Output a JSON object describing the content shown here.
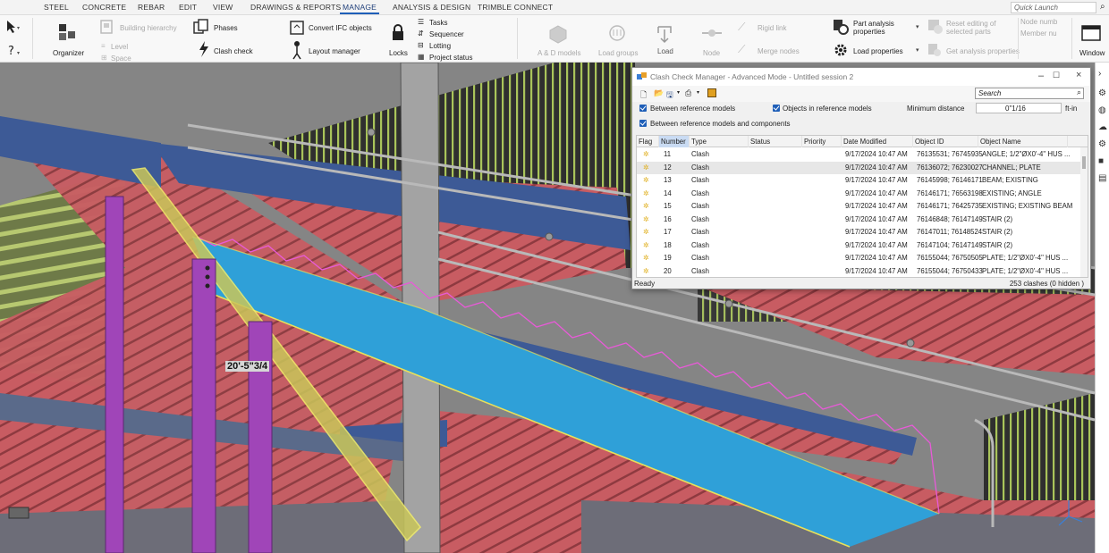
{
  "menu": [
    "STEEL",
    "CONCRETE",
    "REBAR",
    "EDIT",
    "VIEW",
    "DRAWINGS & REPORTS",
    "MANAGE",
    "ANALYSIS & DESIGN",
    "TRIMBLE CONNECT"
  ],
  "quick_launch_placeholder": "Quick Launch",
  "ribbon": {
    "organizer": "Organizer",
    "building_hierarchy": "Building hierarchy",
    "level": "Level",
    "space": "Space",
    "phases": "Phases",
    "clash_check": "Clash check",
    "convert_ifc": "Convert IFC objects",
    "layout_manager": "Layout manager",
    "locks": "Locks",
    "tasks": "Tasks",
    "sequencer": "Sequencer",
    "lotting": "Lotting",
    "project_status": "Project status",
    "ad_models": "A & D models",
    "load_groups": "Load groups",
    "load": "Load",
    "node": "Node",
    "rigid_link": "Rigid link",
    "merge_nodes": "Merge nodes",
    "part_analysis": "Part analysis",
    "properties": "properties",
    "load_properties": "Load properties",
    "reset_editing": "Reset editing of",
    "selected_parts": "selected parts",
    "get_analysis": "Get analysis properties",
    "node_numb": "Node numb",
    "member_nu": "Member nu",
    "window": "Window"
  },
  "dimension_label": "20'-5\"3/4",
  "dialog": {
    "title": "Clash Check Manager - Advanced Mode - Untitled session 2",
    "search_placeholder": "Search",
    "opt_between_ref": "Between reference models",
    "opt_objects_in_ref": "Objects in reference models",
    "opt_between_ref_comp": "Between reference models and components",
    "min_distance_label": "Minimum distance",
    "min_distance_value": "0\"1/16",
    "unit": "ft-in",
    "columns": [
      "Flag",
      "Number",
      "Type",
      "Status",
      "Priority",
      "Date Modified",
      "Object ID",
      "Object Name"
    ],
    "rows": [
      {
        "number": "11",
        "type": "Clash",
        "date": "9/17/2024 10:47 AM",
        "object_id": "76135531; 76745935",
        "object_name": "ANGLE; 1/2\"ØX0'-4\" HUS ..."
      },
      {
        "number": "12",
        "type": "Clash",
        "date": "9/17/2024 10:47 AM",
        "object_id": "76136072; 76230027",
        "object_name": "CHANNEL; PLATE"
      },
      {
        "number": "13",
        "type": "Clash",
        "date": "9/17/2024 10:47 AM",
        "object_id": "76145998; 76146171",
        "object_name": "BEAM; EXISTING"
      },
      {
        "number": "14",
        "type": "Clash",
        "date": "9/17/2024 10:47 AM",
        "object_id": "76146171; 76563198",
        "object_name": "EXISTING; ANGLE"
      },
      {
        "number": "15",
        "type": "Clash",
        "date": "9/17/2024 10:47 AM",
        "object_id": "76146171; 76425735",
        "object_name": "EXISTING; EXISTING BEAM"
      },
      {
        "number": "16",
        "type": "Clash",
        "date": "9/17/2024 10:47 AM",
        "object_id": "76146848; 76147149",
        "object_name": "STAIR (2)"
      },
      {
        "number": "17",
        "type": "Clash",
        "date": "9/17/2024 10:47 AM",
        "object_id": "76147011; 76148524",
        "object_name": "STAIR (2)"
      },
      {
        "number": "18",
        "type": "Clash",
        "date": "9/17/2024 10:47 AM",
        "object_id": "76147104; 76147149",
        "object_name": "STAIR (2)"
      },
      {
        "number": "19",
        "type": "Clash",
        "date": "9/17/2024 10:47 AM",
        "object_id": "76155044; 76750505",
        "object_name": "PLATE; 1/2\"ØX0'-4\" HUS ..."
      },
      {
        "number": "20",
        "type": "Clash",
        "date": "9/17/2024 10:47 AM",
        "object_id": "76155044; 76750433",
        "object_name": "PLATE; 1/2\"ØX0'-4\" HUS ..."
      }
    ],
    "status_left": "Ready",
    "status_right": "253 clashes (0 hidden )"
  },
  "colors": {
    "accent": "#1f5fb8",
    "steel_blue": "#3d5a96",
    "stair_fill": "#2fa0d8",
    "red_steel": "#c75a60",
    "green_rail": "#a8c458",
    "purple_col": "#a045b8",
    "yellow_sel": "#e8e05a"
  }
}
